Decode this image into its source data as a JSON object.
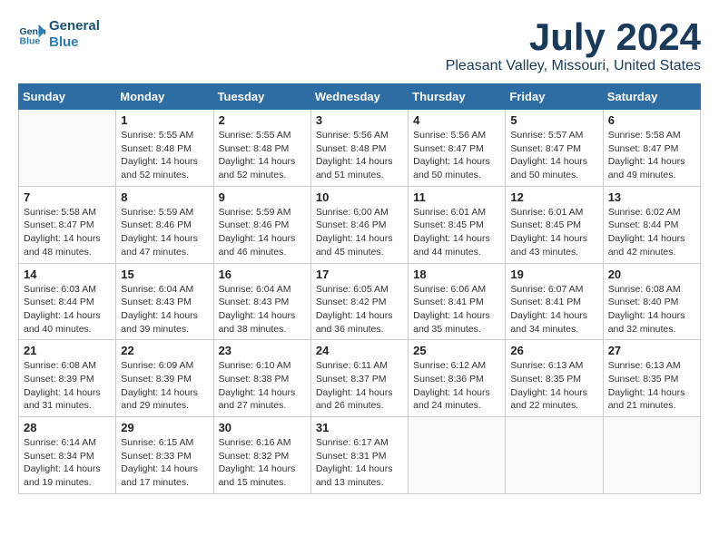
{
  "header": {
    "logo_line1": "General",
    "logo_line2": "Blue",
    "month_title": "July 2024",
    "location": "Pleasant Valley, Missouri, United States"
  },
  "weekdays": [
    "Sunday",
    "Monday",
    "Tuesday",
    "Wednesday",
    "Thursday",
    "Friday",
    "Saturday"
  ],
  "weeks": [
    [
      {
        "day": "",
        "info": ""
      },
      {
        "day": "1",
        "info": "Sunrise: 5:55 AM\nSunset: 8:48 PM\nDaylight: 14 hours\nand 52 minutes."
      },
      {
        "day": "2",
        "info": "Sunrise: 5:55 AM\nSunset: 8:48 PM\nDaylight: 14 hours\nand 52 minutes."
      },
      {
        "day": "3",
        "info": "Sunrise: 5:56 AM\nSunset: 8:48 PM\nDaylight: 14 hours\nand 51 minutes."
      },
      {
        "day": "4",
        "info": "Sunrise: 5:56 AM\nSunset: 8:47 PM\nDaylight: 14 hours\nand 50 minutes."
      },
      {
        "day": "5",
        "info": "Sunrise: 5:57 AM\nSunset: 8:47 PM\nDaylight: 14 hours\nand 50 minutes."
      },
      {
        "day": "6",
        "info": "Sunrise: 5:58 AM\nSunset: 8:47 PM\nDaylight: 14 hours\nand 49 minutes."
      }
    ],
    [
      {
        "day": "7",
        "info": "Sunrise: 5:58 AM\nSunset: 8:47 PM\nDaylight: 14 hours\nand 48 minutes."
      },
      {
        "day": "8",
        "info": "Sunrise: 5:59 AM\nSunset: 8:46 PM\nDaylight: 14 hours\nand 47 minutes."
      },
      {
        "day": "9",
        "info": "Sunrise: 5:59 AM\nSunset: 8:46 PM\nDaylight: 14 hours\nand 46 minutes."
      },
      {
        "day": "10",
        "info": "Sunrise: 6:00 AM\nSunset: 8:46 PM\nDaylight: 14 hours\nand 45 minutes."
      },
      {
        "day": "11",
        "info": "Sunrise: 6:01 AM\nSunset: 8:45 PM\nDaylight: 14 hours\nand 44 minutes."
      },
      {
        "day": "12",
        "info": "Sunrise: 6:01 AM\nSunset: 8:45 PM\nDaylight: 14 hours\nand 43 minutes."
      },
      {
        "day": "13",
        "info": "Sunrise: 6:02 AM\nSunset: 8:44 PM\nDaylight: 14 hours\nand 42 minutes."
      }
    ],
    [
      {
        "day": "14",
        "info": "Sunrise: 6:03 AM\nSunset: 8:44 PM\nDaylight: 14 hours\nand 40 minutes."
      },
      {
        "day": "15",
        "info": "Sunrise: 6:04 AM\nSunset: 8:43 PM\nDaylight: 14 hours\nand 39 minutes."
      },
      {
        "day": "16",
        "info": "Sunrise: 6:04 AM\nSunset: 8:43 PM\nDaylight: 14 hours\nand 38 minutes."
      },
      {
        "day": "17",
        "info": "Sunrise: 6:05 AM\nSunset: 8:42 PM\nDaylight: 14 hours\nand 36 minutes."
      },
      {
        "day": "18",
        "info": "Sunrise: 6:06 AM\nSunset: 8:41 PM\nDaylight: 14 hours\nand 35 minutes."
      },
      {
        "day": "19",
        "info": "Sunrise: 6:07 AM\nSunset: 8:41 PM\nDaylight: 14 hours\nand 34 minutes."
      },
      {
        "day": "20",
        "info": "Sunrise: 6:08 AM\nSunset: 8:40 PM\nDaylight: 14 hours\nand 32 minutes."
      }
    ],
    [
      {
        "day": "21",
        "info": "Sunrise: 6:08 AM\nSunset: 8:39 PM\nDaylight: 14 hours\nand 31 minutes."
      },
      {
        "day": "22",
        "info": "Sunrise: 6:09 AM\nSunset: 8:39 PM\nDaylight: 14 hours\nand 29 minutes."
      },
      {
        "day": "23",
        "info": "Sunrise: 6:10 AM\nSunset: 8:38 PM\nDaylight: 14 hours\nand 27 minutes."
      },
      {
        "day": "24",
        "info": "Sunrise: 6:11 AM\nSunset: 8:37 PM\nDaylight: 14 hours\nand 26 minutes."
      },
      {
        "day": "25",
        "info": "Sunrise: 6:12 AM\nSunset: 8:36 PM\nDaylight: 14 hours\nand 24 minutes."
      },
      {
        "day": "26",
        "info": "Sunrise: 6:13 AM\nSunset: 8:35 PM\nDaylight: 14 hours\nand 22 minutes."
      },
      {
        "day": "27",
        "info": "Sunrise: 6:13 AM\nSunset: 8:35 PM\nDaylight: 14 hours\nand 21 minutes."
      }
    ],
    [
      {
        "day": "28",
        "info": "Sunrise: 6:14 AM\nSunset: 8:34 PM\nDaylight: 14 hours\nand 19 minutes."
      },
      {
        "day": "29",
        "info": "Sunrise: 6:15 AM\nSunset: 8:33 PM\nDaylight: 14 hours\nand 17 minutes."
      },
      {
        "day": "30",
        "info": "Sunrise: 6:16 AM\nSunset: 8:32 PM\nDaylight: 14 hours\nand 15 minutes."
      },
      {
        "day": "31",
        "info": "Sunrise: 6:17 AM\nSunset: 8:31 PM\nDaylight: 14 hours\nand 13 minutes."
      },
      {
        "day": "",
        "info": ""
      },
      {
        "day": "",
        "info": ""
      },
      {
        "day": "",
        "info": ""
      }
    ]
  ]
}
